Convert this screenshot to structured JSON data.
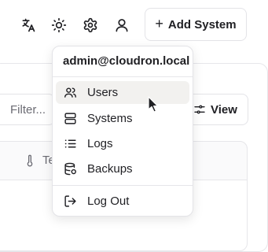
{
  "header": {
    "add_system_label": "Add System",
    "icons": [
      "translate-icon",
      "sun-icon",
      "gear-icon",
      "user-icon"
    ]
  },
  "background": {
    "filter_placeholder": "Filter...",
    "view_label": "View",
    "temperature_column_partial": "Te"
  },
  "user_menu": {
    "email": "admin@cloudron.local",
    "items": [
      {
        "label": "Users",
        "icon": "users-icon",
        "hovered": true
      },
      {
        "label": "Systems",
        "icon": "server-icon"
      },
      {
        "label": "Logs",
        "icon": "list-icon"
      },
      {
        "label": "Backups",
        "icon": "database-backup-icon"
      },
      {
        "label": "Log Out",
        "icon": "logout-icon"
      }
    ]
  },
  "colors": {
    "hover_bg": "#f2f1ef",
    "border": "#e3e3e7",
    "text": "#1f1f23"
  }
}
